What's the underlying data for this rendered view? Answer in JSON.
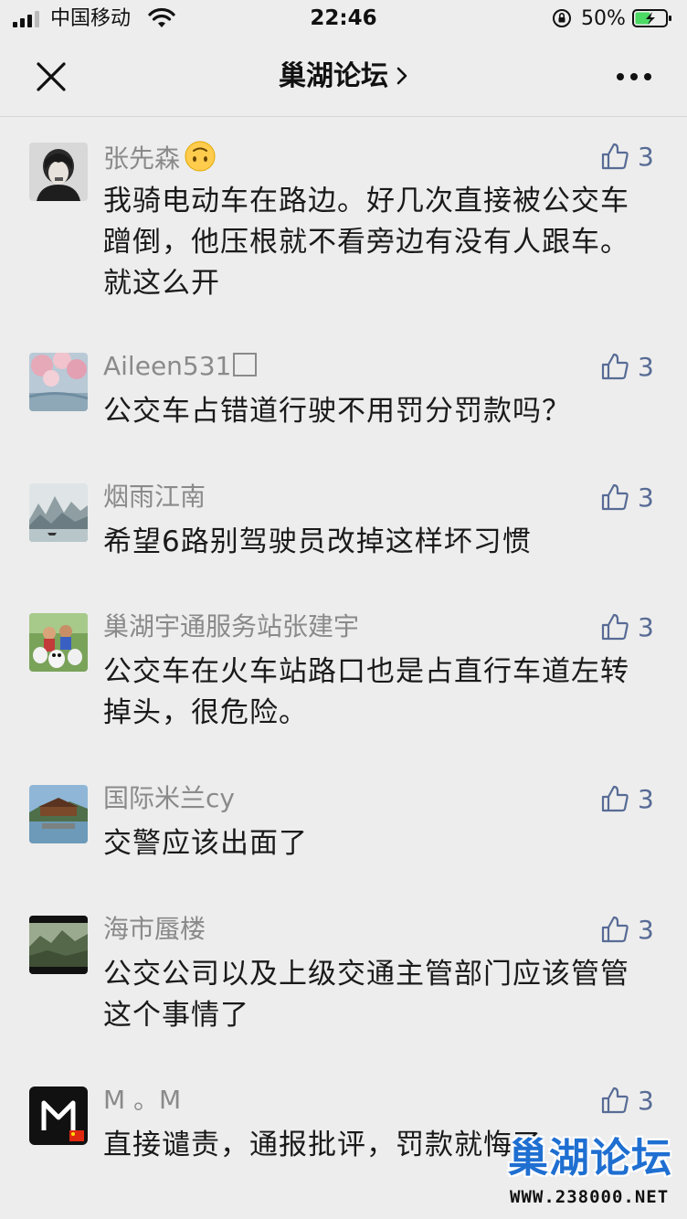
{
  "status_bar": {
    "carrier": "中国移动",
    "time": "22:46",
    "battery_percent": "50%",
    "battery_level": 0.5
  },
  "nav": {
    "title": "巢湖论坛",
    "close_icon": "close-icon",
    "more_icon": "more-icon"
  },
  "comments": [
    {
      "name": "张先森",
      "name_suffix_icon": "upside-down-face-emoji",
      "text": "我骑电动车在路边。好几次直接被公交车蹭倒，他压根就不看旁边有没有人跟车。就这么开",
      "likes": "3"
    },
    {
      "name": "Aileen531",
      "name_suffix_icon": "unknown-glyph-box",
      "text": "公交车占错道行驶不用罚分罚款吗？",
      "likes": "3"
    },
    {
      "name": "烟雨江南",
      "text": "希望6路别驾驶员改掉这样坏习惯",
      "likes": "3"
    },
    {
      "name": "巢湖宇通服务站张建宇",
      "text": "公交车在火车站路口也是占直行车道左转掉头，很危险。",
      "likes": "3"
    },
    {
      "name": "国际米兰cy",
      "text": "交警应该出面了",
      "likes": "3"
    },
    {
      "name": "海市蜃楼",
      "text": "公交公司以及上级交通主管部门应该管管这个事情了",
      "likes": "3"
    },
    {
      "name": "M 。M",
      "text": "直接谴责，通报批评，罚款就悔了",
      "likes": "3"
    }
  ],
  "watermark": {
    "logo_text": "巢湖论坛",
    "url": "WWW.238000.NET"
  },
  "colors": {
    "background": "#ededed",
    "name": "#8a8a8a",
    "like_accent": "#576b95",
    "text": "#1a1a1a"
  }
}
